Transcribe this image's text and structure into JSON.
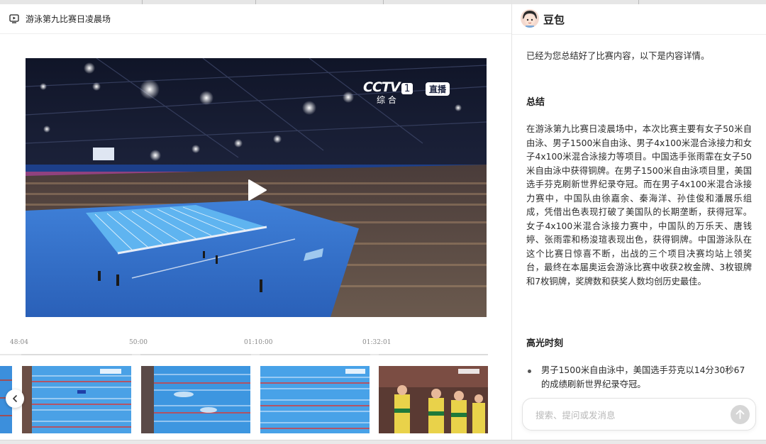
{
  "left_panel": {
    "title": "游泳第九比赛日凌晨场",
    "video": {
      "channel_logo": "CCTV",
      "channel_number": "1",
      "channel_sub": "综 合",
      "live_badge": "直播"
    },
    "timeline": {
      "ticks": [
        "48:04",
        "50:00",
        "01:10:00",
        "01:32:01"
      ]
    }
  },
  "right_panel": {
    "assistant_name": "豆包",
    "intro": "已经为您总结好了比赛内容，以下是内容详情。",
    "summary_heading": "总结",
    "summary_text": "在游泳第九比赛日凌晨场中，本次比赛主要有女子50米自由泳、男子1500米自由泳、男子4x100米混合泳接力和女子4x100米混合泳接力等项目。中国选手张雨霏在女子50米自由泳中获得铜牌。在男子1500米自由泳项目里，美国选手芬克刷新世界纪录夺冠。而在男子4x100米混合泳接力赛中，中国队由徐嘉余、秦海洋、孙佳俊和潘展乐组成，凭借出色表现打破了美国队的长期垄断，获得冠军。女子4x100米混合泳接力赛中，中国队的万乐天、唐钱婷、张雨霏和杨浚瑄表现出色，获得铜牌。中国游泳队在这个比赛日惊喜不断，出战的三个项目决赛均站上领奖台，最终在本届奥运会游泳比赛中收获2枚金牌、3枚银牌和7枚铜牌，奖牌数和获奖人数均创历史最佳。",
    "highlights_heading": "高光时刻",
    "highlights": [
      "男子1500米自由泳中，美国选手芬克以14分30秒67的成绩刷新世界纪录夺冠。"
    ],
    "input": {
      "placeholder": "搜索、提问或发消息",
      "value": ""
    }
  },
  "colors": {
    "pool_blue": "#3a8fe0",
    "send_button": "#d6d6d6",
    "avatar_bg": "#f0c9b8"
  }
}
